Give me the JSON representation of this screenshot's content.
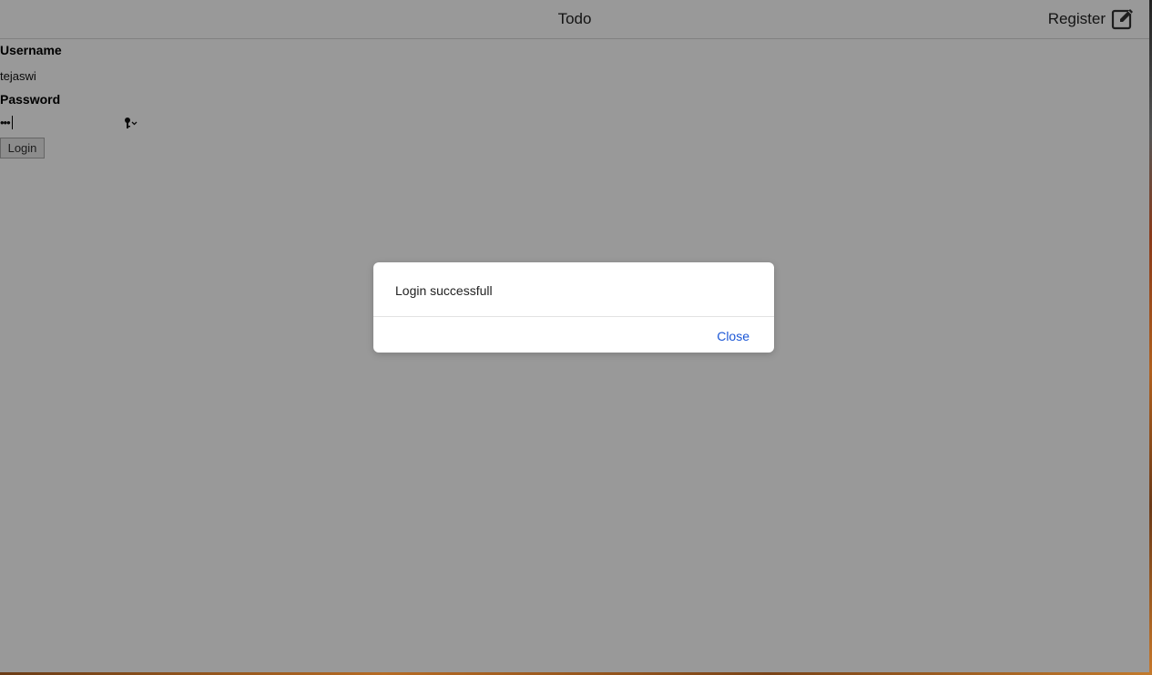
{
  "navbar": {
    "title": "Todo",
    "register_label": "Register",
    "register_icon": "edit-icon"
  },
  "login_form": {
    "username_label": "Username",
    "username_value": "tejaswi",
    "password_label": "Password",
    "password_value": "•••",
    "password_icon": "key-icon",
    "login_button_label": "Login"
  },
  "dialog": {
    "message": "Login successfull",
    "close_label": "Close",
    "close_color": "#1a56d6"
  }
}
